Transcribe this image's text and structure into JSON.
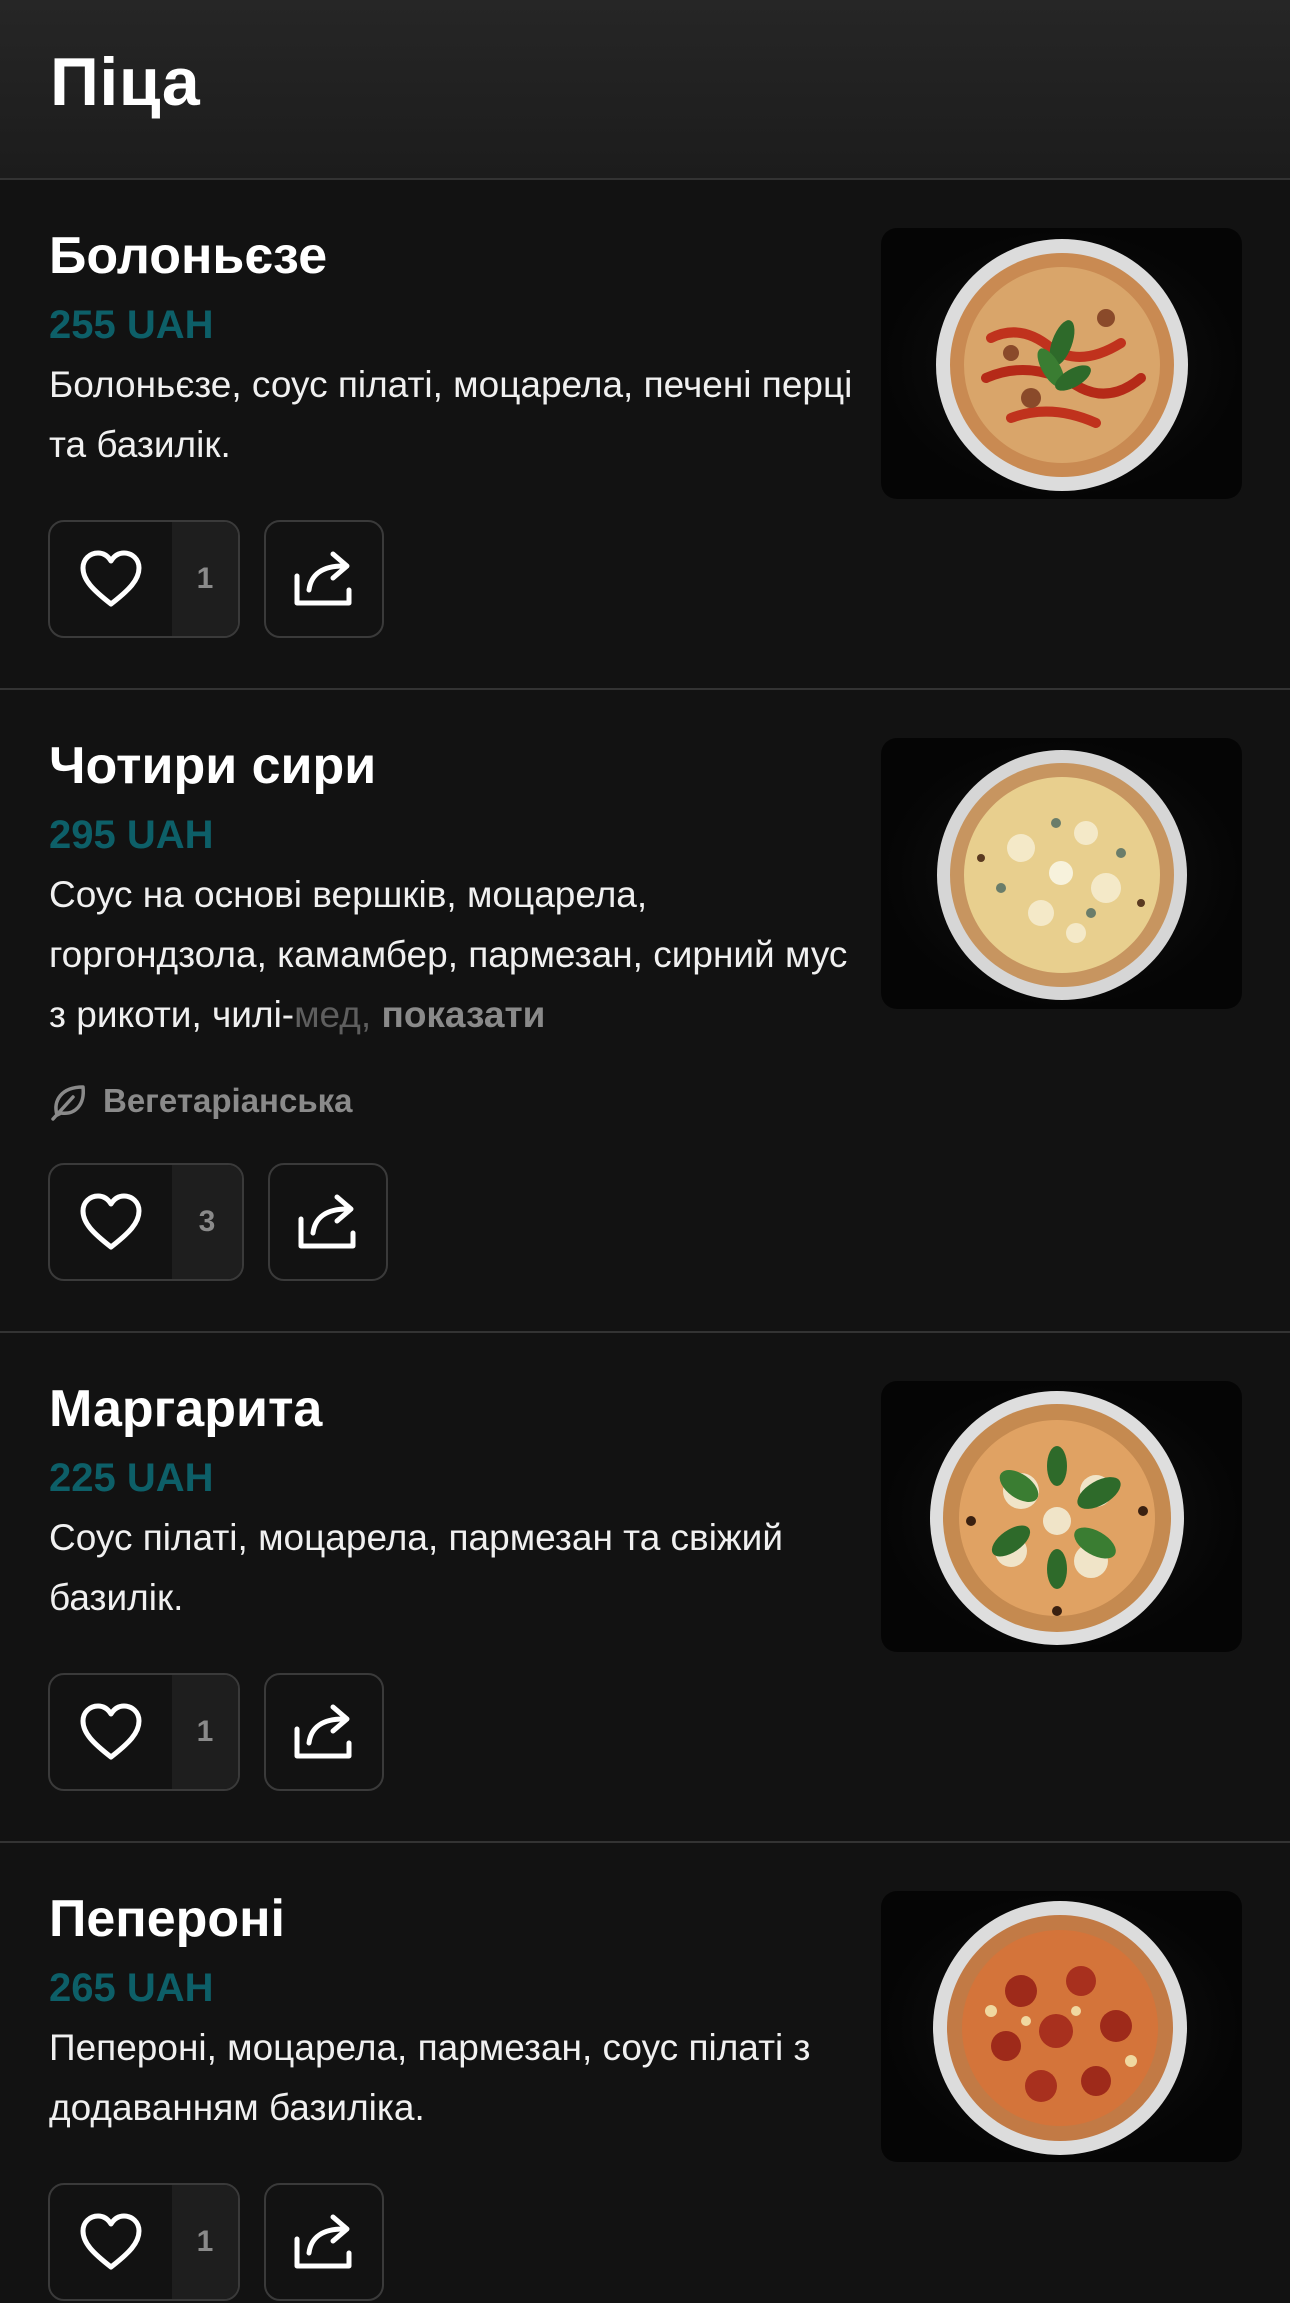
{
  "header": {
    "title": "Піца"
  },
  "items": [
    {
      "name": "Болоньєзе",
      "price": "255 UAH",
      "description": "Болоньєзе, соус пілаті, моцарела, печені перці та базилік.",
      "likes": "1",
      "image_icon": "pizza-bolognese-image"
    },
    {
      "name": "Чотири сири",
      "price": "295 UAH",
      "description": "Соус на основі вершків, моцарела, горгондзола, камамбер, пармезан, сирний мус з рикоти, чилі-",
      "description_faded": "мед,",
      "show_more": "показати",
      "tag": "Вегетаріанська",
      "likes": "3",
      "image_icon": "pizza-four-cheese-image"
    },
    {
      "name": "Маргарита",
      "price": "225 UAH",
      "description": "Соус пілаті, моцарела, пармезан та свіжий базилік.",
      "likes": "1",
      "image_icon": "pizza-margherita-image"
    },
    {
      "name": "Пепероні",
      "price": "265 UAH",
      "description": "Пепероні, моцарела, пармезан, соус пілаті з додаванням базиліка.",
      "likes": "1",
      "image_icon": "pizza-pepperoni-image"
    }
  ],
  "icons": {
    "like": "heart-icon",
    "share": "share-icon",
    "vegetarian": "leaf-icon"
  },
  "colors": {
    "background": "#121212",
    "header_background": "#222222",
    "price": "#0d5f68",
    "muted": "#8a8a8a"
  }
}
